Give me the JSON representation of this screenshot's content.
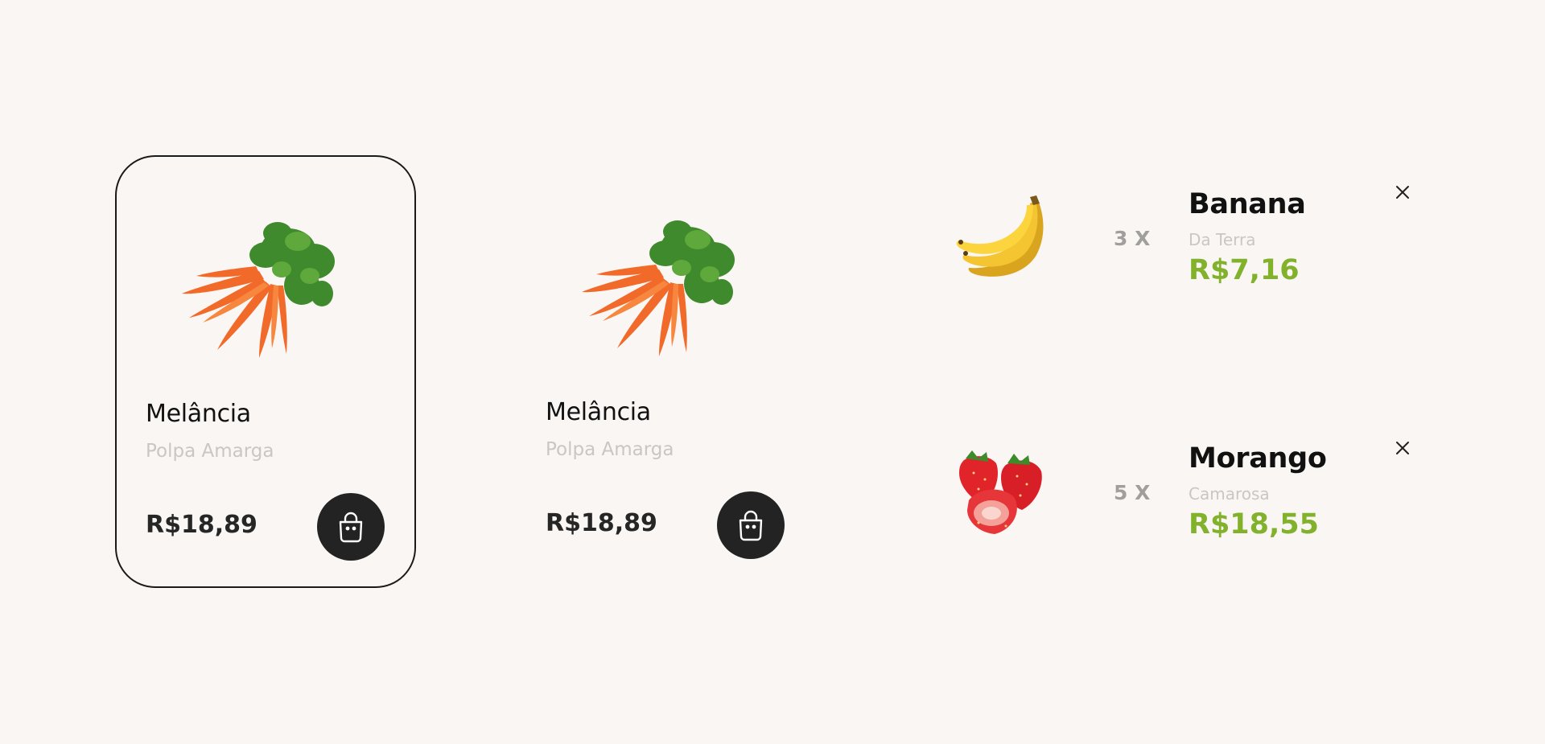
{
  "products": [
    {
      "name": "Melância",
      "subtitle": "Polpa Amarga",
      "price": "R$18,89",
      "image_icon": "carrot-bunch-icon",
      "button_icon": "shopping-bag-icon",
      "selected": true
    },
    {
      "name": "Melância",
      "subtitle": "Polpa Amarga",
      "price": "R$18,89",
      "image_icon": "carrot-bunch-icon",
      "button_icon": "shopping-bag-icon",
      "selected": false
    }
  ],
  "cart": [
    {
      "quantity": "3 X",
      "name": "Banana",
      "subtitle": "Da Terra",
      "price": "R$7,16",
      "image_icon": "banana-icon",
      "remove_icon": "close-icon"
    },
    {
      "quantity": "5 X",
      "name": "Morango",
      "subtitle": "Camarosa",
      "price": "R$18,55",
      "image_icon": "strawberry-icon",
      "remove_icon": "close-icon"
    }
  ],
  "colors": {
    "background": "#faf6f3",
    "accent_green": "#82b12c",
    "dark": "#232323",
    "muted_text": "#c9c6c4",
    "quantity_text": "#a19f9d"
  }
}
